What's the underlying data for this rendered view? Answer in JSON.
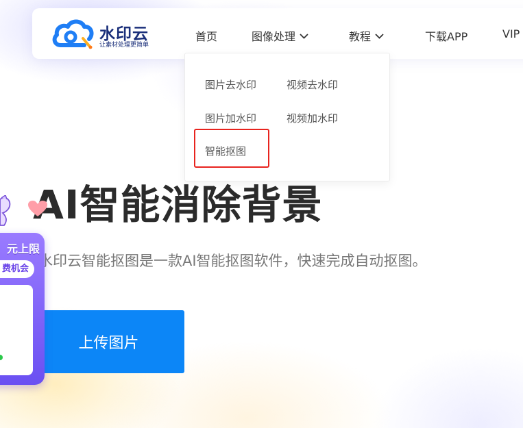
{
  "brand": {
    "name": "水印云",
    "slogan": "让素材处理更简单",
    "primary_color": "#0c86f7",
    "logo_icon": "cloud-logo-icon"
  },
  "nav": {
    "items": [
      {
        "label": "首页"
      },
      {
        "label": "图像处理",
        "has_dropdown": true
      },
      {
        "label": "教程",
        "has_dropdown": true
      },
      {
        "label": "下载APP"
      },
      {
        "label": "VIP"
      }
    ]
  },
  "dropdown": {
    "items": [
      {
        "label": "图片去水印"
      },
      {
        "label": "视频去水印"
      },
      {
        "label": "图片加水印"
      },
      {
        "label": "视频加水印"
      },
      {
        "label": "智能抠图",
        "highlighted": true
      }
    ],
    "highlight_color": "#e8231e"
  },
  "hero": {
    "title": "AI智能消除背景",
    "subtitle": "水印云智能抠图是一款AI智能抠图软件，快速完成自动抠图。",
    "upload_label": "上传图片"
  },
  "promo": {
    "headline": "元上限",
    "pill": "费机会",
    "bg_color": "#7c5cf7"
  }
}
